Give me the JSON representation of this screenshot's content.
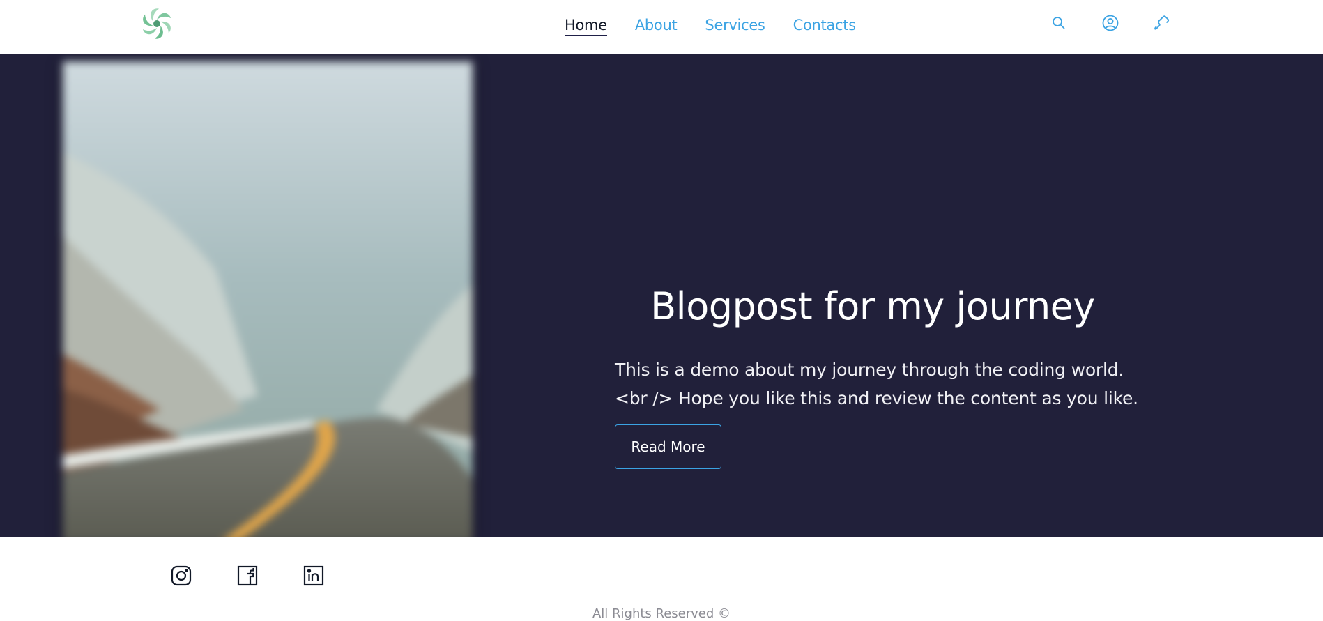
{
  "header": {
    "logo": "pinwheel-logo",
    "nav": [
      {
        "label": "Home",
        "active": true
      },
      {
        "label": "About",
        "active": false
      },
      {
        "label": "Services",
        "active": false
      },
      {
        "label": "Contacts",
        "active": false
      }
    ],
    "icons": [
      "search-icon",
      "user-icon",
      "phone-icon"
    ]
  },
  "hero": {
    "image": "blurred-winter-road-photo",
    "title": "Blogpost for my journey",
    "description": "This is a demo about my journey through the coding world. <br /> Hope you like this and review the content as you like.",
    "button_label": "Read More"
  },
  "footer": {
    "social_icons": [
      "instagram-icon",
      "facebook-icon",
      "linkedin-icon"
    ],
    "copyright": "All Rights Reserved ©"
  },
  "colors": {
    "accent": "#3ba3e3",
    "hero_bg": "#21203a",
    "logo_green": "#7fc79f",
    "nav_underline": "#1f2048"
  }
}
